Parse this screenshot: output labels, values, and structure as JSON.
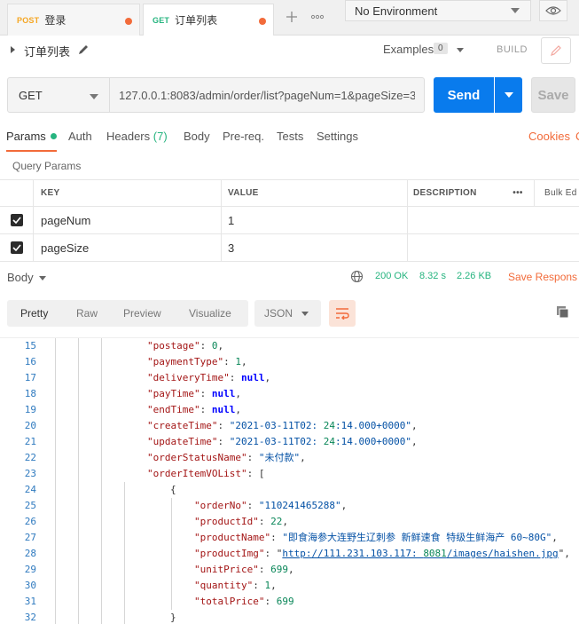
{
  "tabs": [
    {
      "method": "POST",
      "title": "登录"
    },
    {
      "method": "GET",
      "title": "订单列表"
    }
  ],
  "environment": {
    "selected": "No Environment"
  },
  "request": {
    "name": "订单列表",
    "examples_label": "Examples",
    "examples_count": "0",
    "build_label": "BUILD",
    "method": "GET",
    "url": "127.0.0.1:8083/admin/order/list?pageNum=1&pageSize=3",
    "send_label": "Send",
    "save_label": "Save"
  },
  "request_tabs": {
    "params": "Params",
    "auth": "Auth",
    "headers": "Headers",
    "headers_count": "(7)",
    "body": "Body",
    "prereq": "Pre-req.",
    "tests": "Tests",
    "settings": "Settings",
    "cookies": "Cookies",
    "code": "C"
  },
  "query_params": {
    "label": "Query Params",
    "headers": {
      "key": "KEY",
      "value": "VALUE",
      "description": "DESCRIPTION",
      "bulk_edit": "Bulk Ed"
    },
    "rows": [
      {
        "key": "pageNum",
        "value": "1",
        "checked": true
      },
      {
        "key": "pageSize",
        "value": "3",
        "checked": true
      }
    ]
  },
  "response": {
    "body_label": "Body",
    "status": "200 OK",
    "time": "8.32 s",
    "size": "2.26 KB",
    "save_response": "Save Respons",
    "view_tabs": [
      "Pretty",
      "Raw",
      "Preview",
      "Visualize"
    ],
    "format": "JSON"
  },
  "code_lines": [
    {
      "n": "15",
      "text": "\"postage\": 0,"
    },
    {
      "n": "16",
      "text": "\"paymentType\": 1,"
    },
    {
      "n": "17",
      "text": "\"deliveryTime\": null,"
    },
    {
      "n": "18",
      "text": "\"payTime\": null,"
    },
    {
      "n": "19",
      "text": "\"endTime\": null,"
    },
    {
      "n": "20",
      "text": "\"createTime\": \"2021-03-11T02:24:14.000+0000\","
    },
    {
      "n": "21",
      "text": "\"updateTime\": \"2021-03-11T02:24:14.000+0000\","
    },
    {
      "n": "22",
      "text": "\"orderStatusName\": \"未付款\","
    },
    {
      "n": "23",
      "text": "\"orderItemVOList\": ["
    },
    {
      "n": "24",
      "text": "{"
    },
    {
      "n": "25",
      "text": "\"orderNo\": \"110241465288\","
    },
    {
      "n": "26",
      "text": "\"productId\": 22,"
    },
    {
      "n": "27",
      "text": "\"productName\": \"即食海参大连野生辽刺参 新鲜速食 特级生鲜海产 60~80G\","
    },
    {
      "n": "28",
      "text": "\"productImg\": \"http://111.231.103.117:8081/images/haishen.jpg\","
    },
    {
      "n": "29",
      "text": "\"unitPrice\": 699,"
    },
    {
      "n": "30",
      "text": "\"quantity\": 1,"
    },
    {
      "n": "31",
      "text": "\"totalPrice\": 699"
    },
    {
      "n": "32",
      "text": "}"
    }
  ],
  "colors": {
    "accent": "#f26b3a",
    "send": "#097bed",
    "success": "#26b47f"
  }
}
